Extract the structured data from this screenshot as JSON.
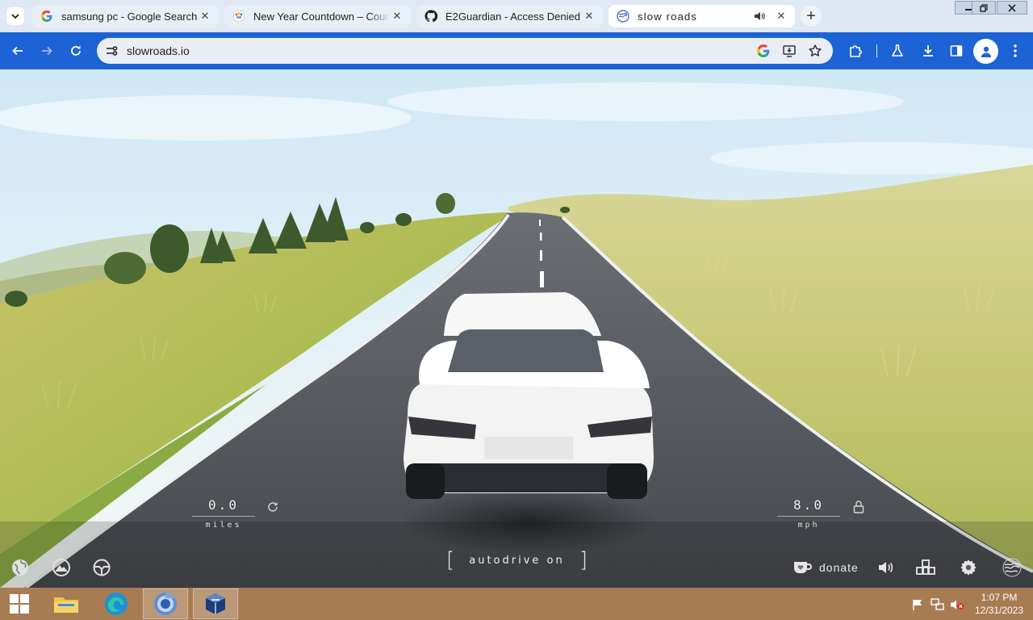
{
  "browser": {
    "tabs": [
      {
        "title": "samsung pc - Google Search",
        "icon": "google-g-icon",
        "active": false
      },
      {
        "title": "New Year Countdown – Countdown",
        "icon": "countdown-site-icon",
        "active": false
      },
      {
        "title": "E2Guardian - Access Denied",
        "icon": "github-icon",
        "active": false
      },
      {
        "title": "slow roads",
        "icon": "slow-roads-icon",
        "active": true,
        "audio": true
      }
    ],
    "new_tab_label": "+",
    "close_glyph": "✕",
    "address": "slowroads.io",
    "colors": {
      "toolbar": "#1d63d6",
      "tabstrip": "#dfe8f3",
      "omnibox": "#e9eef6"
    }
  },
  "game": {
    "odometer": {
      "value": "0.0",
      "unit": "miles"
    },
    "speedometer": {
      "value": "8.0",
      "unit": "mph"
    },
    "autodrive": {
      "left_bracket": "[",
      "label": "autodrive on",
      "right_bracket": "]"
    },
    "donate_label": "donate",
    "bottom_left_icons": [
      "globe-icon",
      "mountain-icon",
      "steering-wheel-icon"
    ],
    "bottom_right_icons": [
      "donate-cup-icon",
      "volume-icon",
      "cubes-icon",
      "gear-icon",
      "logo-swirl-icon"
    ]
  },
  "taskbar": {
    "apps": [
      {
        "name": "file-explorer",
        "running": false
      },
      {
        "name": "edge",
        "running": false
      },
      {
        "name": "chrome",
        "running": true
      },
      {
        "name": "virtualbox",
        "running": true
      }
    ],
    "clock": {
      "time": "1:07 PM",
      "date": "12/31/2023"
    },
    "color": "#a87c52"
  }
}
